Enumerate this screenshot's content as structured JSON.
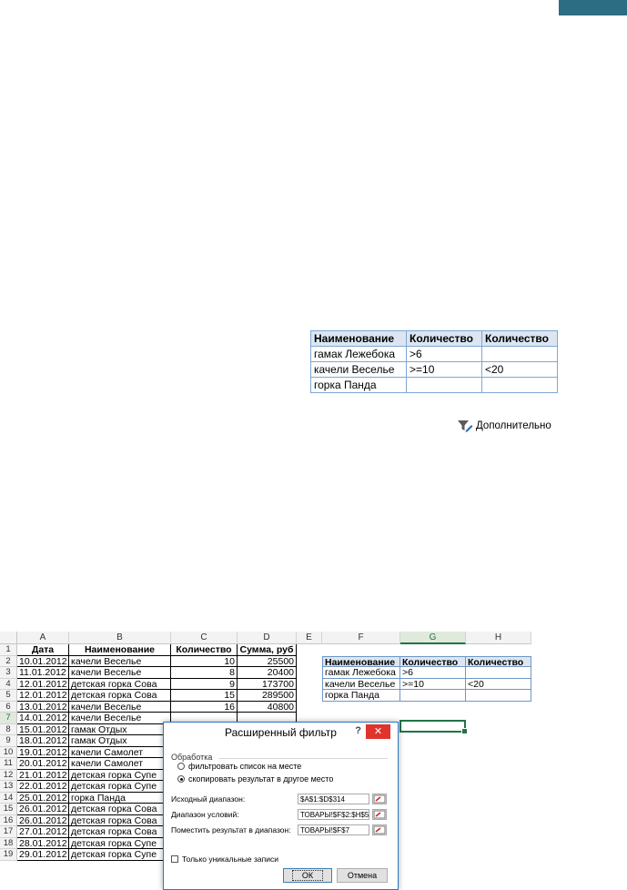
{
  "criteria_table": {
    "headers": [
      "Наименование",
      "Количество",
      "Количество"
    ],
    "rows": [
      [
        "гамак Лежебока",
        ">6",
        ""
      ],
      [
        "качели Веселье",
        ">=10",
        "<20"
      ],
      [
        "горка Панда",
        "",
        ""
      ]
    ]
  },
  "advanced_button": {
    "label": "Дополнительно",
    "icon": "filter-advanced-icon"
  },
  "sheet": {
    "columns": [
      "A",
      "B",
      "C",
      "D",
      "E",
      "F",
      "G",
      "H"
    ],
    "selected_column": "G",
    "selected_row": "7",
    "row_numbers": [
      "1",
      "2",
      "3",
      "4",
      "5",
      "6",
      "7",
      "8",
      "9",
      "10",
      "11",
      "12",
      "13",
      "14",
      "15",
      "16",
      "17",
      "18",
      "19"
    ],
    "headers": [
      "Дата",
      "Наименование",
      "Количество",
      "Сумма, руб"
    ],
    "rows": [
      [
        "10.01.2012",
        "качели Веселье",
        "10",
        "25500"
      ],
      [
        "11.01.2012",
        "качели Веселье",
        "8",
        "20400"
      ],
      [
        "12.01.2012",
        "детская горка Сова",
        "9",
        "173700"
      ],
      [
        "12.01.2012",
        "детская горка Сова",
        "15",
        "289500"
      ],
      [
        "13.01.2012",
        "качели Веселье",
        "16",
        "40800"
      ],
      [
        "14.01.2012",
        "качели Веселье",
        "",
        ""
      ],
      [
        "15.01.2012",
        "гамак Отдых",
        "",
        ""
      ],
      [
        "18.01.2012",
        "гамак Отдых",
        "",
        ""
      ],
      [
        "19.01.2012",
        "качели Самолет",
        "",
        ""
      ],
      [
        "20.01.2012",
        "качели Самолет",
        "",
        ""
      ],
      [
        "21.01.2012",
        "детская горка Супе",
        "",
        ""
      ],
      [
        "22.01.2012",
        "детская горка Супе",
        "",
        ""
      ],
      [
        "25.01.2012",
        "горка Панда",
        "",
        ""
      ],
      [
        "26.01.2012",
        "детская горка Сова",
        "",
        ""
      ],
      [
        "26.01.2012",
        "детская горка Сова",
        "",
        ""
      ],
      [
        "27.01.2012",
        "детская горка Сова",
        "",
        ""
      ],
      [
        "28.01.2012",
        "детская горка Супе",
        "",
        ""
      ],
      [
        "29.01.2012",
        "детская горка Супе",
        "",
        ""
      ]
    ],
    "criteria": {
      "headers": [
        "Наименование",
        "Количество",
        "Количество"
      ],
      "rows": [
        [
          "гамак Лежебока",
          ">6",
          ""
        ],
        [
          "качели Веселье",
          ">=10",
          "<20"
        ],
        [
          "горка Панда",
          "",
          ""
        ]
      ]
    }
  },
  "dialog": {
    "title": "Расширенный фильтр",
    "help": "?",
    "close": "✕",
    "group_label": "Обработка",
    "radio_filter_in_place": "фильтровать список на месте",
    "radio_copy_to": "скопировать результат в другое место",
    "selected_option": "copy_to",
    "source_range_label": "Исходный диапазон:",
    "source_range_value": "$A$1:$D$314",
    "criteria_range_label": "Диапазон условий:",
    "criteria_range_value": "ТОВАРЫ!$F$2:$H$5",
    "output_range_label": "Поместить результат в диапазон:",
    "output_range_value": "ТОВАРЫ!$F$7",
    "unique_label": "Только уникальные записи",
    "unique_checked": false,
    "ok_label": "ОК",
    "cancel_label": "Отмена"
  }
}
